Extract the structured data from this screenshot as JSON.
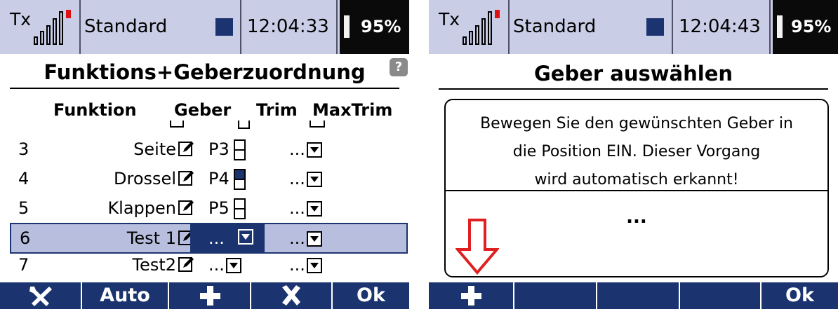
{
  "left": {
    "status": {
      "tx": "Tx",
      "model": "Standard",
      "time": "12:04:33",
      "battery": "95%"
    },
    "title": "Funktions+Geberzuordnung",
    "help": "?",
    "headers": {
      "funktion": "Funktion",
      "geber": "Geber",
      "trim": "Trim",
      "maxtrim": "MaxTrim"
    },
    "rows": [
      {
        "num": "3",
        "name": "Seite",
        "geber": "P3",
        "trim": "..."
      },
      {
        "num": "4",
        "name": "Drossel",
        "geber": "P4",
        "trim": "..."
      },
      {
        "num": "5",
        "name": "Klappen",
        "geber": "P5",
        "trim": "..."
      },
      {
        "num": "6",
        "name": "Test 1",
        "geber": "...",
        "trim": "..."
      },
      {
        "num": "7",
        "name": "Test2",
        "geber": "...",
        "trim": "..."
      }
    ],
    "softkeys": [
      "Auto",
      "Ok"
    ]
  },
  "right": {
    "status": {
      "tx": "Tx",
      "model": "Standard",
      "time": "12:04:43",
      "battery": "95%"
    },
    "title": "Geber auswählen",
    "message_lines": [
      "Bewegen Sie den gewünschten Geber in",
      "die Position EIN. Dieser Vorgang",
      "wird automatisch erkannt!"
    ],
    "value": "...",
    "softkeys": [
      "Ok"
    ]
  },
  "colors": {
    "statusbar": "#c9cde6",
    "accent": "#1b3470",
    "selection": "#b8bede",
    "arrow": "#e02020"
  },
  "icons": [
    "signal-icon",
    "model-color-icon",
    "battery-icon",
    "help-icon",
    "pencil-icon",
    "wrench-icon",
    "plus-icon",
    "close-icon",
    "arrow-down-icon"
  ]
}
